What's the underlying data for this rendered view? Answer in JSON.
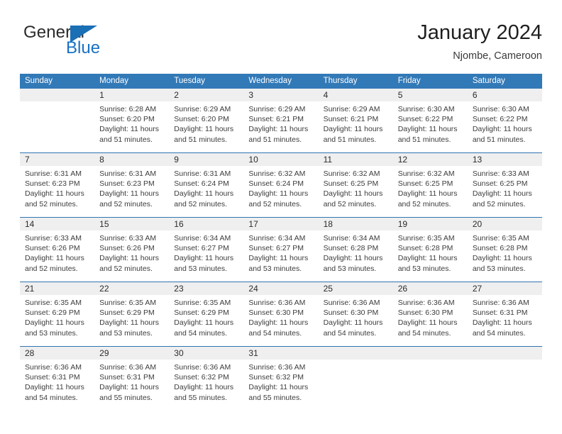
{
  "brand": {
    "name_part1": "General",
    "name_part2": "Blue",
    "flag_icon": "flag-triangle-icon",
    "accent_color": "#1a71c4"
  },
  "header": {
    "title": "January 2024",
    "subtitle": "Njombe, Cameroon"
  },
  "theme": {
    "header_blue": "#3279b7",
    "row_divider_blue": "#2f74b1",
    "number_band_gray": "#efefef",
    "text_color": "#3c3c3c"
  },
  "weekday_headers": [
    "Sunday",
    "Monday",
    "Tuesday",
    "Wednesday",
    "Thursday",
    "Friday",
    "Saturday"
  ],
  "labels": {
    "sunrise_prefix": "Sunrise:",
    "sunset_prefix": "Sunset:",
    "daylight_prefix": "Daylight:"
  },
  "weeks": [
    {
      "days": [
        {
          "num": "",
          "sunrise": "",
          "sunset": "",
          "daylight_line1": "",
          "daylight_line2": ""
        },
        {
          "num": "1",
          "sunrise": "Sunrise: 6:28 AM",
          "sunset": "Sunset: 6:20 PM",
          "daylight_line1": "Daylight: 11 hours",
          "daylight_line2": "and 51 minutes."
        },
        {
          "num": "2",
          "sunrise": "Sunrise: 6:29 AM",
          "sunset": "Sunset: 6:20 PM",
          "daylight_line1": "Daylight: 11 hours",
          "daylight_line2": "and 51 minutes."
        },
        {
          "num": "3",
          "sunrise": "Sunrise: 6:29 AM",
          "sunset": "Sunset: 6:21 PM",
          "daylight_line1": "Daylight: 11 hours",
          "daylight_line2": "and 51 minutes."
        },
        {
          "num": "4",
          "sunrise": "Sunrise: 6:29 AM",
          "sunset": "Sunset: 6:21 PM",
          "daylight_line1": "Daylight: 11 hours",
          "daylight_line2": "and 51 minutes."
        },
        {
          "num": "5",
          "sunrise": "Sunrise: 6:30 AM",
          "sunset": "Sunset: 6:22 PM",
          "daylight_line1": "Daylight: 11 hours",
          "daylight_line2": "and 51 minutes."
        },
        {
          "num": "6",
          "sunrise": "Sunrise: 6:30 AM",
          "sunset": "Sunset: 6:22 PM",
          "daylight_line1": "Daylight: 11 hours",
          "daylight_line2": "and 51 minutes."
        }
      ]
    },
    {
      "days": [
        {
          "num": "7",
          "sunrise": "Sunrise: 6:31 AM",
          "sunset": "Sunset: 6:23 PM",
          "daylight_line1": "Daylight: 11 hours",
          "daylight_line2": "and 52 minutes."
        },
        {
          "num": "8",
          "sunrise": "Sunrise: 6:31 AM",
          "sunset": "Sunset: 6:23 PM",
          "daylight_line1": "Daylight: 11 hours",
          "daylight_line2": "and 52 minutes."
        },
        {
          "num": "9",
          "sunrise": "Sunrise: 6:31 AM",
          "sunset": "Sunset: 6:24 PM",
          "daylight_line1": "Daylight: 11 hours",
          "daylight_line2": "and 52 minutes."
        },
        {
          "num": "10",
          "sunrise": "Sunrise: 6:32 AM",
          "sunset": "Sunset: 6:24 PM",
          "daylight_line1": "Daylight: 11 hours",
          "daylight_line2": "and 52 minutes."
        },
        {
          "num": "11",
          "sunrise": "Sunrise: 6:32 AM",
          "sunset": "Sunset: 6:25 PM",
          "daylight_line1": "Daylight: 11 hours",
          "daylight_line2": "and 52 minutes."
        },
        {
          "num": "12",
          "sunrise": "Sunrise: 6:32 AM",
          "sunset": "Sunset: 6:25 PM",
          "daylight_line1": "Daylight: 11 hours",
          "daylight_line2": "and 52 minutes."
        },
        {
          "num": "13",
          "sunrise": "Sunrise: 6:33 AM",
          "sunset": "Sunset: 6:25 PM",
          "daylight_line1": "Daylight: 11 hours",
          "daylight_line2": "and 52 minutes."
        }
      ]
    },
    {
      "days": [
        {
          "num": "14",
          "sunrise": "Sunrise: 6:33 AM",
          "sunset": "Sunset: 6:26 PM",
          "daylight_line1": "Daylight: 11 hours",
          "daylight_line2": "and 52 minutes."
        },
        {
          "num": "15",
          "sunrise": "Sunrise: 6:33 AM",
          "sunset": "Sunset: 6:26 PM",
          "daylight_line1": "Daylight: 11 hours",
          "daylight_line2": "and 52 minutes."
        },
        {
          "num": "16",
          "sunrise": "Sunrise: 6:34 AM",
          "sunset": "Sunset: 6:27 PM",
          "daylight_line1": "Daylight: 11 hours",
          "daylight_line2": "and 53 minutes."
        },
        {
          "num": "17",
          "sunrise": "Sunrise: 6:34 AM",
          "sunset": "Sunset: 6:27 PM",
          "daylight_line1": "Daylight: 11 hours",
          "daylight_line2": "and 53 minutes."
        },
        {
          "num": "18",
          "sunrise": "Sunrise: 6:34 AM",
          "sunset": "Sunset: 6:28 PM",
          "daylight_line1": "Daylight: 11 hours",
          "daylight_line2": "and 53 minutes."
        },
        {
          "num": "19",
          "sunrise": "Sunrise: 6:35 AM",
          "sunset": "Sunset: 6:28 PM",
          "daylight_line1": "Daylight: 11 hours",
          "daylight_line2": "and 53 minutes."
        },
        {
          "num": "20",
          "sunrise": "Sunrise: 6:35 AM",
          "sunset": "Sunset: 6:28 PM",
          "daylight_line1": "Daylight: 11 hours",
          "daylight_line2": "and 53 minutes."
        }
      ]
    },
    {
      "days": [
        {
          "num": "21",
          "sunrise": "Sunrise: 6:35 AM",
          "sunset": "Sunset: 6:29 PM",
          "daylight_line1": "Daylight: 11 hours",
          "daylight_line2": "and 53 minutes."
        },
        {
          "num": "22",
          "sunrise": "Sunrise: 6:35 AM",
          "sunset": "Sunset: 6:29 PM",
          "daylight_line1": "Daylight: 11 hours",
          "daylight_line2": "and 53 minutes."
        },
        {
          "num": "23",
          "sunrise": "Sunrise: 6:35 AM",
          "sunset": "Sunset: 6:29 PM",
          "daylight_line1": "Daylight: 11 hours",
          "daylight_line2": "and 54 minutes."
        },
        {
          "num": "24",
          "sunrise": "Sunrise: 6:36 AM",
          "sunset": "Sunset: 6:30 PM",
          "daylight_line1": "Daylight: 11 hours",
          "daylight_line2": "and 54 minutes."
        },
        {
          "num": "25",
          "sunrise": "Sunrise: 6:36 AM",
          "sunset": "Sunset: 6:30 PM",
          "daylight_line1": "Daylight: 11 hours",
          "daylight_line2": "and 54 minutes."
        },
        {
          "num": "26",
          "sunrise": "Sunrise: 6:36 AM",
          "sunset": "Sunset: 6:30 PM",
          "daylight_line1": "Daylight: 11 hours",
          "daylight_line2": "and 54 minutes."
        },
        {
          "num": "27",
          "sunrise": "Sunrise: 6:36 AM",
          "sunset": "Sunset: 6:31 PM",
          "daylight_line1": "Daylight: 11 hours",
          "daylight_line2": "and 54 minutes."
        }
      ]
    },
    {
      "days": [
        {
          "num": "28",
          "sunrise": "Sunrise: 6:36 AM",
          "sunset": "Sunset: 6:31 PM",
          "daylight_line1": "Daylight: 11 hours",
          "daylight_line2": "and 54 minutes."
        },
        {
          "num": "29",
          "sunrise": "Sunrise: 6:36 AM",
          "sunset": "Sunset: 6:31 PM",
          "daylight_line1": "Daylight: 11 hours",
          "daylight_line2": "and 55 minutes."
        },
        {
          "num": "30",
          "sunrise": "Sunrise: 6:36 AM",
          "sunset": "Sunset: 6:32 PM",
          "daylight_line1": "Daylight: 11 hours",
          "daylight_line2": "and 55 minutes."
        },
        {
          "num": "31",
          "sunrise": "Sunrise: 6:36 AM",
          "sunset": "Sunset: 6:32 PM",
          "daylight_line1": "Daylight: 11 hours",
          "daylight_line2": "and 55 minutes."
        },
        {
          "num": "",
          "sunrise": "",
          "sunset": "",
          "daylight_line1": "",
          "daylight_line2": ""
        },
        {
          "num": "",
          "sunrise": "",
          "sunset": "",
          "daylight_line1": "",
          "daylight_line2": ""
        },
        {
          "num": "",
          "sunrise": "",
          "sunset": "",
          "daylight_line1": "",
          "daylight_line2": ""
        }
      ]
    }
  ]
}
